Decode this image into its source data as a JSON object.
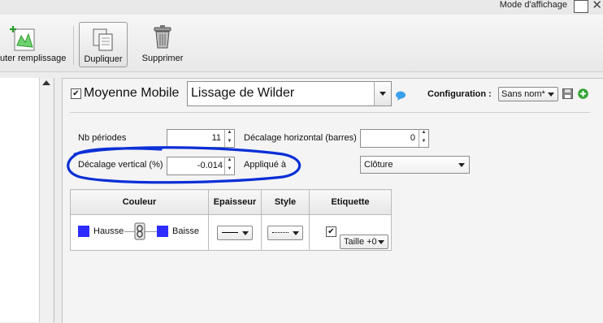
{
  "topbar": {
    "mode_label": "Mode d'affichage"
  },
  "toolbar": {
    "add_fill_label": "uter remplissage",
    "duplicate_label": "Dupliquer",
    "delete_label": "Supprimer"
  },
  "indicator": {
    "enabled_label": "Moyenne Mobile",
    "type_value": "Lissage de Wilder",
    "config_label": "Configuration :",
    "config_value": "Sans nom*"
  },
  "params": {
    "periods_label": "Nb périodes",
    "periods_value": "11",
    "hshift_label": "Décalage horizontal (barres)",
    "hshift_value": "0",
    "vshift_label": "Décalage vertical (%)",
    "vshift_value": "-0.014",
    "applied_label": "Appliqué à",
    "applied_value": "Clôture"
  },
  "style_table": {
    "headers": [
      "Couleur",
      "Epaisseur",
      "Style",
      "Etiquette"
    ],
    "rise_label": "Hausse",
    "fall_label": "Baisse",
    "label_size": "Taille +0",
    "colors": {
      "rise": "#2d2dff",
      "fall": "#2d2dff"
    }
  },
  "annotation": {
    "color": "#0a2fd6"
  }
}
